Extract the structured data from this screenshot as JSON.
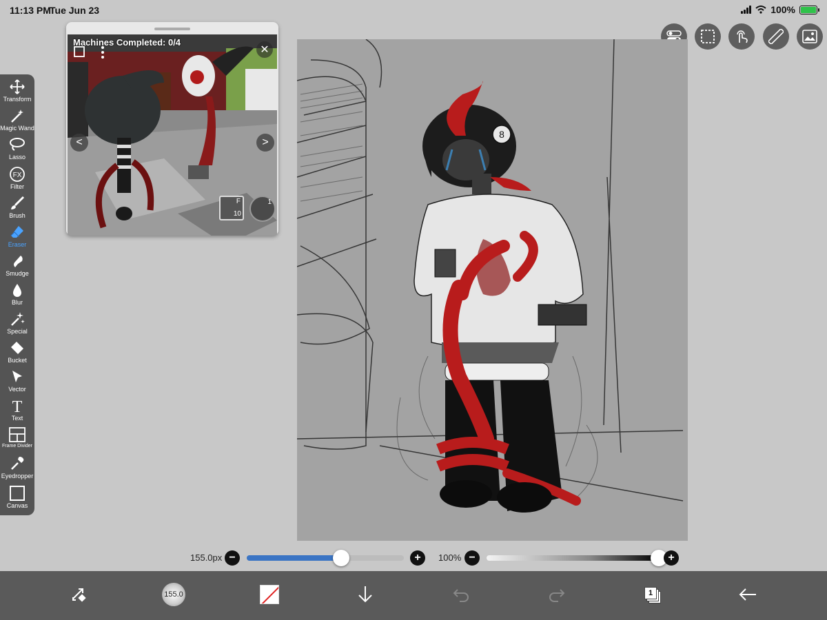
{
  "status_bar": {
    "time": "11:13 PM",
    "date": "Tue Jun 23",
    "battery_text": "100%",
    "battery_level": 1.0
  },
  "toolbar": {
    "tools": [
      {
        "id": "transform",
        "label": "Transform",
        "icon": "move-arrows-icon"
      },
      {
        "id": "magic-wand",
        "label": "Magic Wand",
        "icon": "magic-wand-icon"
      },
      {
        "id": "lasso",
        "label": "Lasso",
        "icon": "lasso-icon"
      },
      {
        "id": "filter",
        "label": "Filter",
        "icon": "fx-icon"
      },
      {
        "id": "brush",
        "label": "Brush",
        "icon": "brush-icon"
      },
      {
        "id": "eraser",
        "label": "Eraser",
        "icon": "eraser-icon",
        "active": true
      },
      {
        "id": "smudge",
        "label": "Smudge",
        "icon": "smudge-icon"
      },
      {
        "id": "blur",
        "label": "Blur",
        "icon": "droplet-icon"
      },
      {
        "id": "special",
        "label": "Special",
        "icon": "sparkle-icon"
      },
      {
        "id": "bucket",
        "label": "Bucket",
        "icon": "bucket-icon"
      },
      {
        "id": "vector",
        "label": "Vector",
        "icon": "cursor-arrow-icon"
      },
      {
        "id": "text",
        "label": "Text",
        "icon": "text-icon"
      },
      {
        "id": "frame-divider",
        "label": "Frame Divider",
        "icon": "frame-divider-icon"
      },
      {
        "id": "eyedropper",
        "label": "Eyedropper",
        "icon": "eyedropper-icon"
      },
      {
        "id": "canvas",
        "label": "Canvas",
        "icon": "canvas-icon"
      }
    ],
    "active_color": "#4aa3ff"
  },
  "reference_window": {
    "caption": "Machines Completed: 0/4",
    "hud_item_key": "F",
    "hud_item_count": "10",
    "hud_slot_number": "1"
  },
  "top_buttons": [
    "toggle-icon",
    "selection-icon",
    "touch-gesture-icon",
    "ruler-icon",
    "image-reference-icon"
  ],
  "brush_size": {
    "value_text": "155.0px",
    "fraction": 0.6
  },
  "opacity": {
    "value_text": "100%",
    "fraction": 1.0
  },
  "bottom_bar": {
    "brush_preview_text": "155.0",
    "layer_count": "1",
    "items": [
      "swap-icon",
      "brush-preview",
      "color-swatch",
      "download-icon",
      "undo-icon",
      "redo-icon",
      "layers-icon",
      "back-arrow-icon"
    ]
  },
  "colors": {
    "toolbar_bg": "#545454",
    "bottom_bar_bg": "#5a5a5a",
    "slider_accent": "#3a74c4",
    "battery_green": "#2fc24a"
  }
}
